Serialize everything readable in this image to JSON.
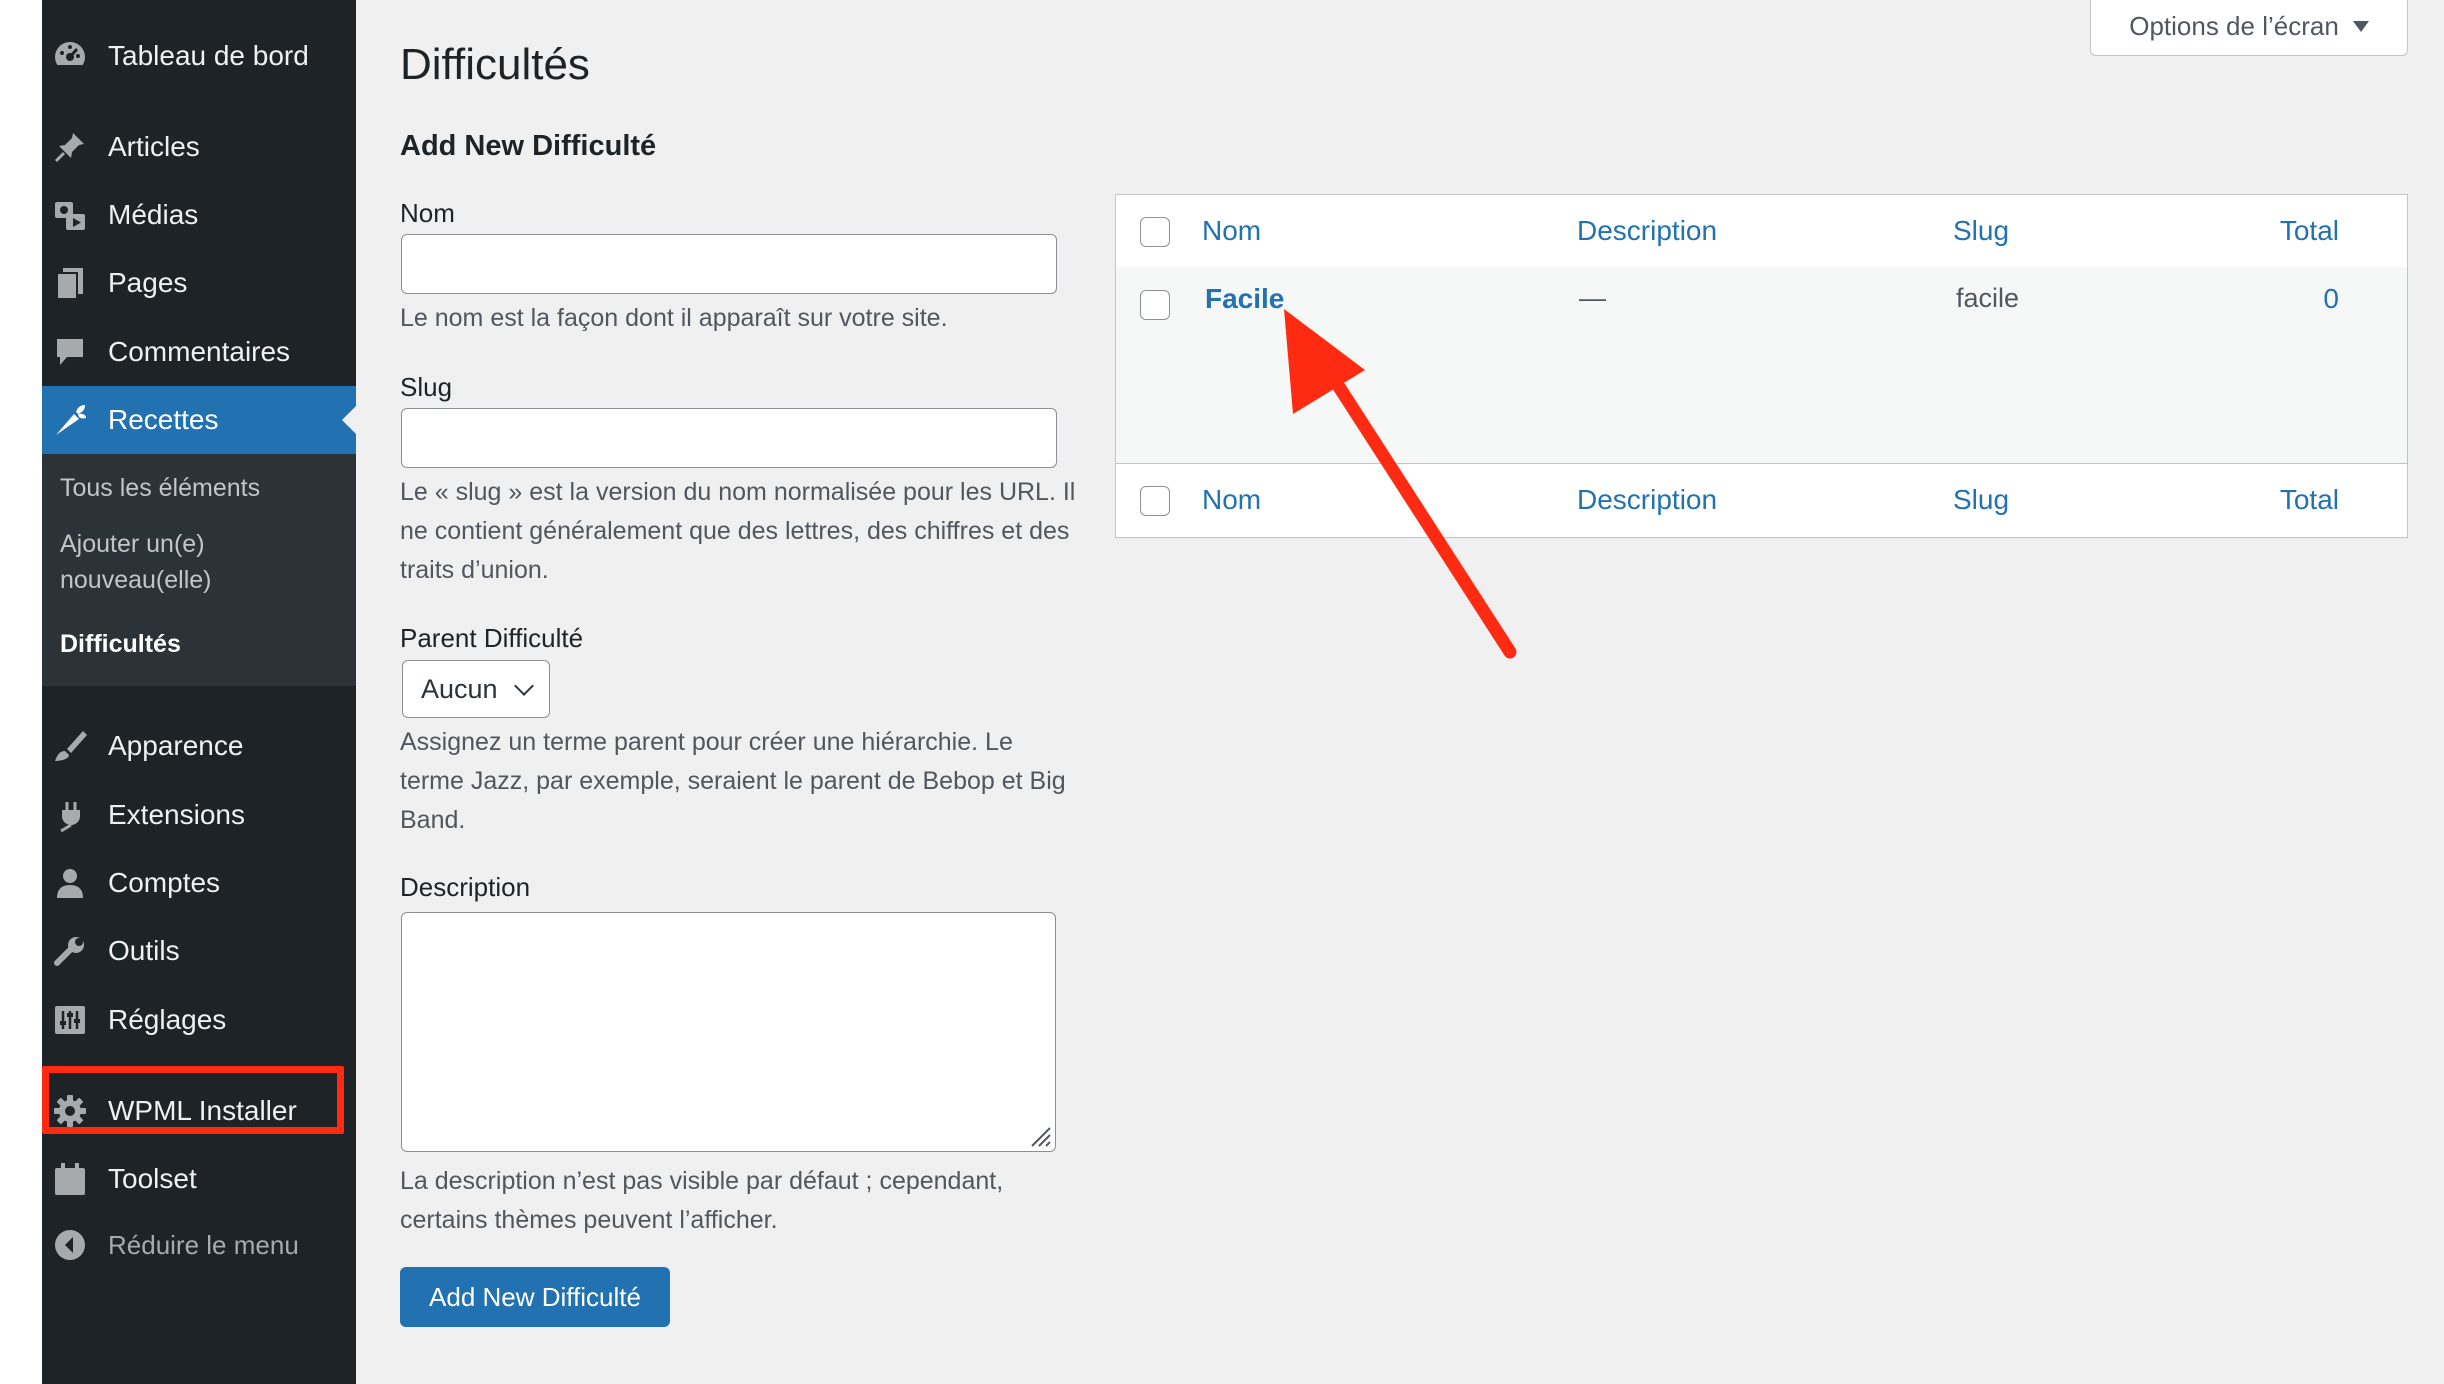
{
  "sidebar": {
    "items": [
      {
        "label": "Tableau de bord",
        "icon": "dashboard-icon"
      },
      {
        "label": "Articles",
        "icon": "pin-icon"
      },
      {
        "label": "Médias",
        "icon": "media-icon"
      },
      {
        "label": "Pages",
        "icon": "pages-icon"
      },
      {
        "label": "Commentaires",
        "icon": "comments-icon"
      },
      {
        "label": "Recettes",
        "icon": "carrot-icon"
      },
      {
        "label": "Apparence",
        "icon": "paintbrush-icon"
      },
      {
        "label": "Extensions",
        "icon": "plugin-icon"
      },
      {
        "label": "Comptes",
        "icon": "users-icon"
      },
      {
        "label": "Outils",
        "icon": "wrench-icon"
      },
      {
        "label": "Réglages",
        "icon": "settings-sliders-icon"
      },
      {
        "label": "WPML Installer",
        "icon": "gear-icon"
      },
      {
        "label": "Toolset",
        "icon": "calendar-icon"
      }
    ],
    "submenu": {
      "all": "Tous les éléments",
      "add_line1": "Ajouter un(e)",
      "add_line2": "nouveau(elle)",
      "current": "Difficultés"
    },
    "collapse_label": "Réduire le menu"
  },
  "page": {
    "title": "Difficultés",
    "screen_options": "Options de l’écran"
  },
  "form": {
    "title": "Add New Difficulté",
    "name_label": "Nom",
    "name_help": "Le nom est la façon dont il apparaît sur votre site.",
    "slug_label": "Slug",
    "slug_help": "Le « slug » est la version du nom normalisée pour les URL. Il ne contient généralement que des lettres, des chiffres et des traits d’union.",
    "parent_label": "Parent Difficulté",
    "parent_value": "Aucun",
    "parent_help": "Assignez un terme parent pour créer une hiérarchie. Le terme Jazz, par exemple, seraient le parent de Bebop et Big Band.",
    "description_label": "Description",
    "description_help": "La description n’est pas visible par défaut ; cependant, certains thèmes peuvent l’afficher.",
    "submit": "Add New Difficulté"
  },
  "table": {
    "columns": {
      "name": "Nom",
      "description": "Description",
      "slug": "Slug",
      "total": "Total"
    },
    "rows": [
      {
        "name": "Facile",
        "description": "—",
        "slug": "facile",
        "count": "0"
      }
    ]
  },
  "colors": {
    "sidebar_bg": "#1d2327",
    "accent": "#2271b1",
    "annotation": "#ff2a12"
  }
}
